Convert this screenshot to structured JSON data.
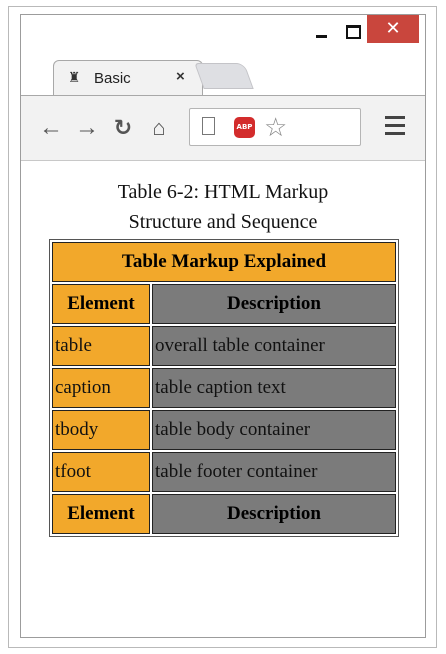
{
  "browser": {
    "tab_title": "Basic",
    "tab_close": "×",
    "close_glyph": "✕",
    "abp_label": "ABP"
  },
  "page": {
    "caption_line1": "Table 6-2: HTML Markup",
    "caption_line2": "Structure and Sequence",
    "table": {
      "title": "Table Markup Explained",
      "header": [
        "Element",
        "Description"
      ],
      "rows": [
        [
          "table",
          "overall table container"
        ],
        [
          "caption",
          "table caption text"
        ],
        [
          "tbody",
          "table body container"
        ],
        [
          "tfoot",
          "table footer container"
        ]
      ],
      "footer": [
        "Element",
        "Description"
      ]
    }
  },
  "colors": {
    "orange": "#f2a82b",
    "gray": "#7b7b7b",
    "close_red": "#c9463d"
  }
}
